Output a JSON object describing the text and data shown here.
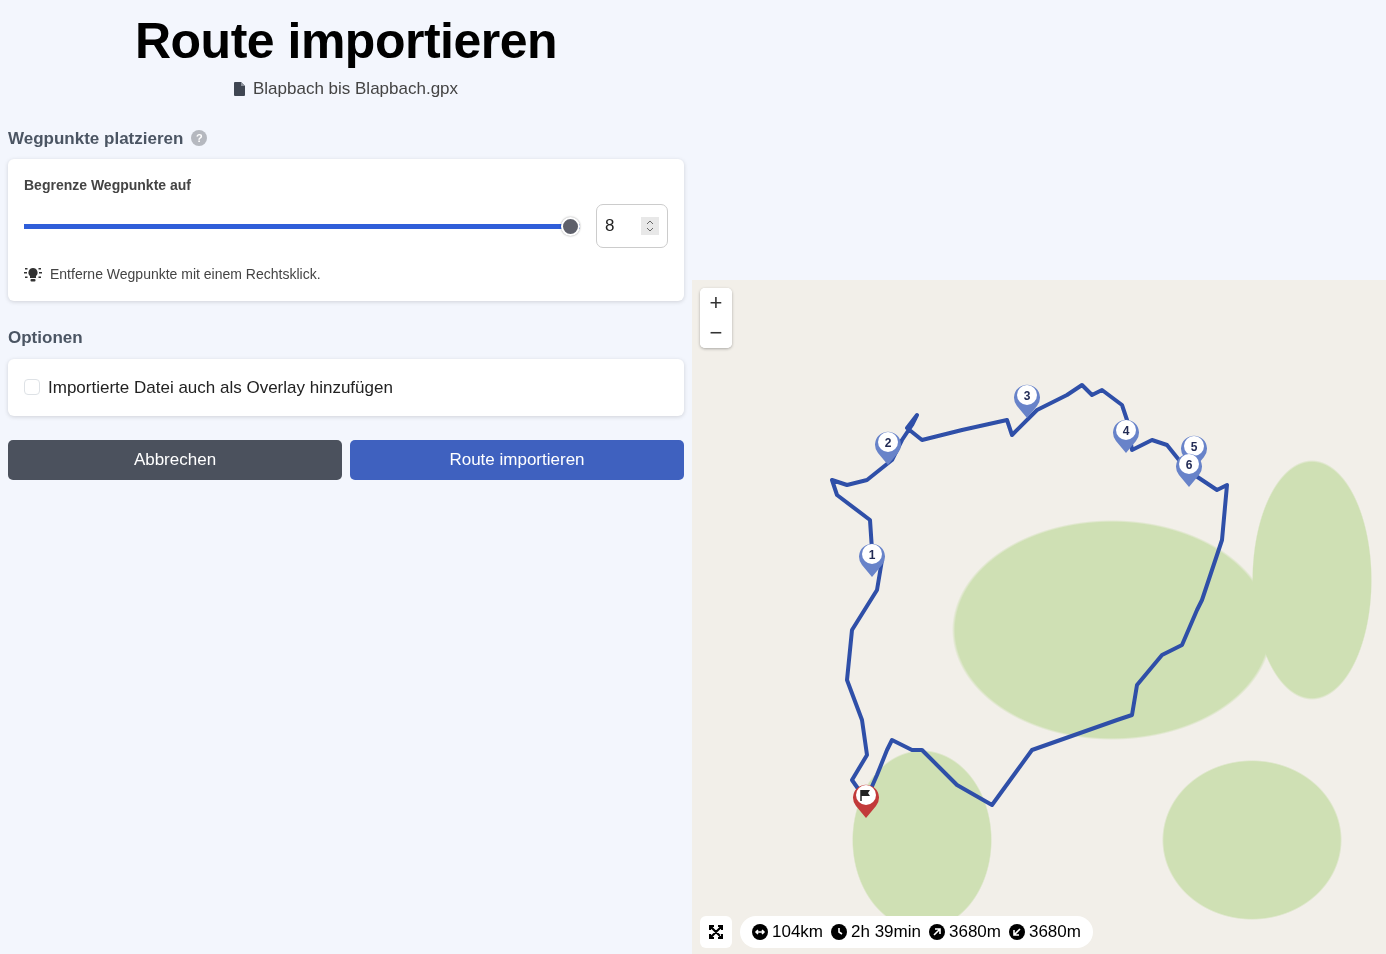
{
  "title": "Route importieren",
  "file": {
    "name": "Blapbach bis Blapbach.gpx"
  },
  "waypoints_section": {
    "heading": "Wegpunkte platzieren",
    "help_icon": "?",
    "limit_label": "Begrenze Wegpunkte auf",
    "slider": {
      "level": 1.0
    },
    "number_field": {
      "value": "8"
    },
    "hint": "Entferne Wegpunkte mit einem Rechtsklick."
  },
  "options_section": {
    "heading": "Optionen",
    "options": [
      {
        "label": "Importierte Datei auch als Overlay hinzufügen",
        "checked": false
      }
    ]
  },
  "buttons": [
    {
      "label": "Abbrechen",
      "kind": "secondary"
    },
    {
      "label": "Route importieren",
      "kind": "primary"
    }
  ],
  "map": {
    "zoom_controls": [
      "+",
      "−"
    ],
    "markers": [
      {
        "kind": "waypoint",
        "label": "1"
      },
      {
        "kind": "waypoint",
        "label": "2"
      },
      {
        "kind": "waypoint",
        "label": "3"
      },
      {
        "kind": "waypoint",
        "label": "4"
      },
      {
        "kind": "waypoint",
        "label": "5"
      },
      {
        "kind": "waypoint",
        "label": "6"
      },
      {
        "kind": "finish"
      }
    ],
    "stats": [
      {
        "kind": "distance",
        "text": "104km"
      },
      {
        "kind": "time",
        "text": "2h 39min"
      },
      {
        "kind": "ascent",
        "text": "3680m"
      },
      {
        "kind": "descent",
        "text": "3680m"
      }
    ]
  }
}
